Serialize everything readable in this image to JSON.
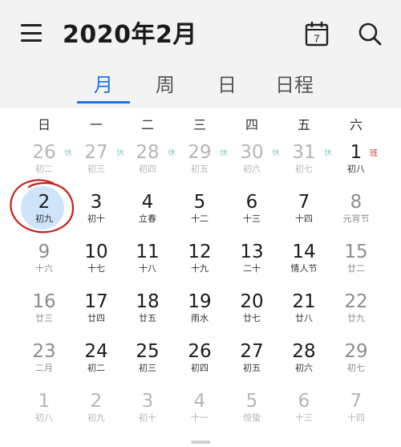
{
  "header": {
    "title": "2020年2月",
    "today_icon_day": "7"
  },
  "tabs": [
    {
      "label": "月",
      "active": true
    },
    {
      "label": "周",
      "active": false
    },
    {
      "label": "日",
      "active": false
    },
    {
      "label": "日程",
      "active": false
    }
  ],
  "weekdays": [
    "日",
    "一",
    "二",
    "三",
    "四",
    "五",
    "六"
  ],
  "weeks": [
    [
      {
        "day": "26",
        "lunar": "初二",
        "other": true,
        "badge": "休",
        "badge_type": "rest"
      },
      {
        "day": "27",
        "lunar": "初三",
        "other": true,
        "badge": "休",
        "badge_type": "rest"
      },
      {
        "day": "28",
        "lunar": "初四",
        "other": true,
        "badge": "休",
        "badge_type": "rest"
      },
      {
        "day": "29",
        "lunar": "初五",
        "other": true,
        "badge": "休",
        "badge_type": "rest"
      },
      {
        "day": "30",
        "lunar": "初六",
        "other": true,
        "badge": "休",
        "badge_type": "rest"
      },
      {
        "day": "31",
        "lunar": "初七",
        "other": true,
        "badge": "休",
        "badge_type": "rest"
      },
      {
        "day": "1",
        "lunar": "初八",
        "other": false,
        "weekend": false,
        "badge": "班",
        "badge_type": "work"
      }
    ],
    [
      {
        "day": "2",
        "lunar": "初九",
        "other": false,
        "selected": true
      },
      {
        "day": "3",
        "lunar": "初十"
      },
      {
        "day": "4",
        "lunar": "立春"
      },
      {
        "day": "5",
        "lunar": "十二"
      },
      {
        "day": "6",
        "lunar": "十三"
      },
      {
        "day": "7",
        "lunar": "十四"
      },
      {
        "day": "8",
        "lunar": "元宵节",
        "weekend": true
      }
    ],
    [
      {
        "day": "9",
        "lunar": "十六",
        "weekend": true
      },
      {
        "day": "10",
        "lunar": "十七"
      },
      {
        "day": "11",
        "lunar": "十八"
      },
      {
        "day": "12",
        "lunar": "十九"
      },
      {
        "day": "13",
        "lunar": "二十"
      },
      {
        "day": "14",
        "lunar": "情人节"
      },
      {
        "day": "15",
        "lunar": "廿二",
        "weekend": true
      }
    ],
    [
      {
        "day": "16",
        "lunar": "廿三",
        "weekend": true
      },
      {
        "day": "17",
        "lunar": "廿四"
      },
      {
        "day": "18",
        "lunar": "廿五"
      },
      {
        "day": "19",
        "lunar": "雨水"
      },
      {
        "day": "20",
        "lunar": "廿七"
      },
      {
        "day": "21",
        "lunar": "廿八"
      },
      {
        "day": "22",
        "lunar": "廿九",
        "weekend": true
      }
    ],
    [
      {
        "day": "23",
        "lunar": "二月",
        "weekend": true
      },
      {
        "day": "24",
        "lunar": "初二"
      },
      {
        "day": "25",
        "lunar": "初三"
      },
      {
        "day": "26",
        "lunar": "初四"
      },
      {
        "day": "27",
        "lunar": "初五"
      },
      {
        "day": "28",
        "lunar": "初六"
      },
      {
        "day": "29",
        "lunar": "初七",
        "weekend": true
      }
    ],
    [
      {
        "day": "1",
        "lunar": "初八",
        "other": true
      },
      {
        "day": "2",
        "lunar": "初九",
        "other": true
      },
      {
        "day": "3",
        "lunar": "初十",
        "other": true
      },
      {
        "day": "4",
        "lunar": "十一",
        "other": true
      },
      {
        "day": "5",
        "lunar": "惊蛰",
        "other": true
      },
      {
        "day": "6",
        "lunar": "十三",
        "other": true
      },
      {
        "day": "7",
        "lunar": "十四",
        "other": true
      }
    ]
  ],
  "colors": {
    "accent": "#1a73e8",
    "selected_fill": "#cfe4f8",
    "rest_badge": "#8fcfd3",
    "work_badge": "#c8372d",
    "annotation": "#c8201a"
  }
}
